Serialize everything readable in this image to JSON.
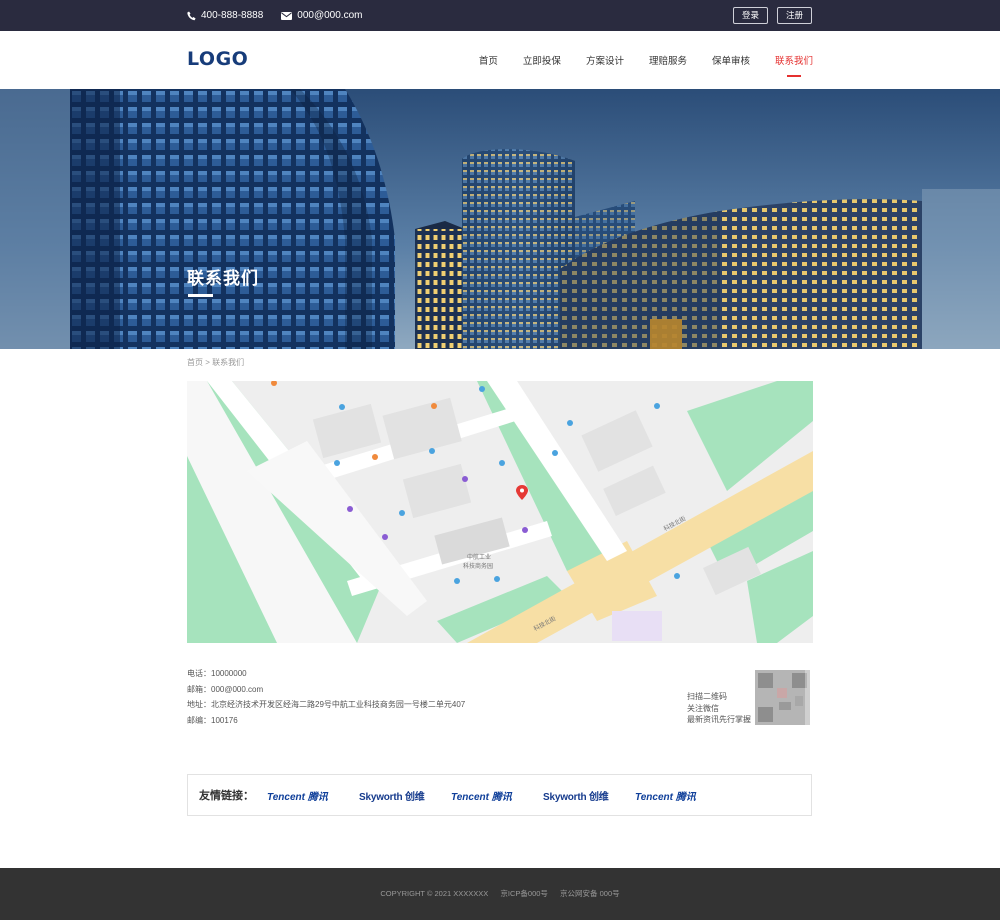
{
  "topbar": {
    "phone": "400-888-8888",
    "email": "000@000.com",
    "login_label": "登录",
    "register_label": "注册"
  },
  "header": {
    "logo_text": "LOGO",
    "nav": [
      {
        "label": "首页"
      },
      {
        "label": "立即投保"
      },
      {
        "label": "方案设计"
      },
      {
        "label": "理赔服务"
      },
      {
        "label": "保单审核"
      },
      {
        "label": "联系我们",
        "active": true
      }
    ]
  },
  "banner": {
    "title": "联系我们"
  },
  "breadcrumb": {
    "home": "首页",
    "separator": ">",
    "current": "联系我们"
  },
  "map": {
    "labels": {
      "area_1": "中航工业",
      "area_2": "科技商务园",
      "road_1": "科技北街",
      "road_2": "科技北街"
    }
  },
  "contact": {
    "phone_label": "电话：",
    "phone": "10000000",
    "email_label": "邮箱：",
    "email": "000@000.com",
    "address_label": "地址：",
    "address": "北京经济技术开发区经海二路29号中航工业科技商务园一号楼二单元407",
    "postcode_label": "邮编：",
    "postcode": "100176"
  },
  "qr": {
    "line1": "扫描二维码",
    "line2": "关注微信",
    "line3": "最新资讯先行掌握"
  },
  "friend_links": {
    "label": "友情链接：",
    "partners": [
      "Tencent 腾讯",
      "Skyworth 创维",
      "Tencent 腾讯",
      "Skyworth 创维",
      "Tencent 腾讯"
    ]
  },
  "footer": {
    "copyright": "COPYRIGHT © 2021 XXXXXXX",
    "icp": "京ICP备000号",
    "police": "京公网安备 000号"
  },
  "colors": {
    "topbar_bg": "#2a2b3f",
    "accent": "#e5302f",
    "logo": "#173c7a",
    "footer_bg": "#333333"
  }
}
